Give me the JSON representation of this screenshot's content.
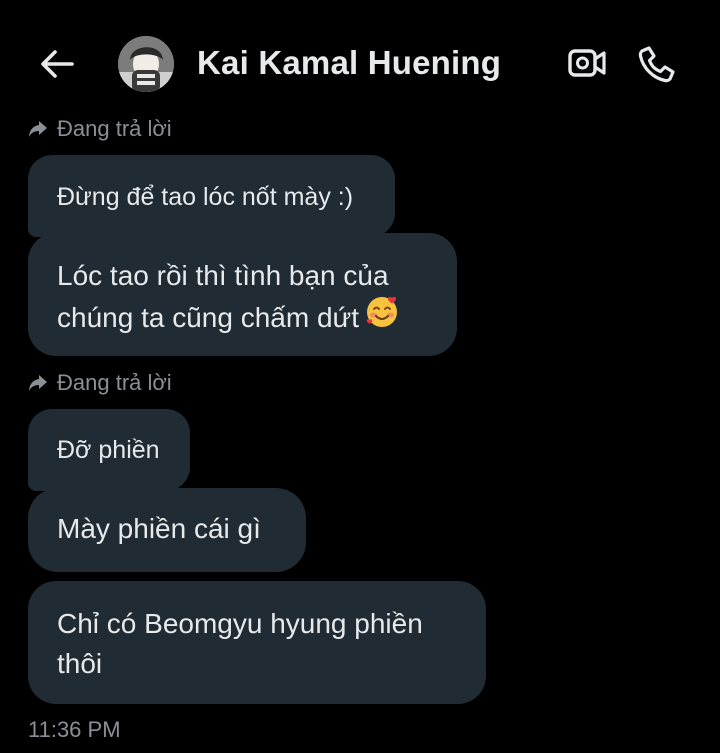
{
  "colors": {
    "background": "#000000",
    "bubble": "#202b33",
    "text": "#e7e9ea",
    "muted": "#8b9096"
  },
  "header": {
    "back_icon": "arrow-left-icon",
    "contact_name": "Kai Kamal Huening",
    "video_icon": "video-camera-icon",
    "call_icon": "phone-icon"
  },
  "messages": [
    {
      "reply_label": "Đang trả lời",
      "quoted_text": "Đừng để tao lóc nốt mày :)",
      "lines": [
        "Lóc tao rồi thì tình bạn của",
        "chúng ta cũng chấm dứt"
      ],
      "emoji": "smiling-face-with-hearts"
    },
    {
      "reply_label": "Đang trả lời",
      "quoted_text": "Đỡ phiền",
      "lines": [
        "Mày phiền cái gì"
      ]
    },
    {
      "lines": [
        "Chỉ có Beomgyu hyung phiền",
        "thôi"
      ]
    }
  ],
  "timestamp": "11:36 PM"
}
